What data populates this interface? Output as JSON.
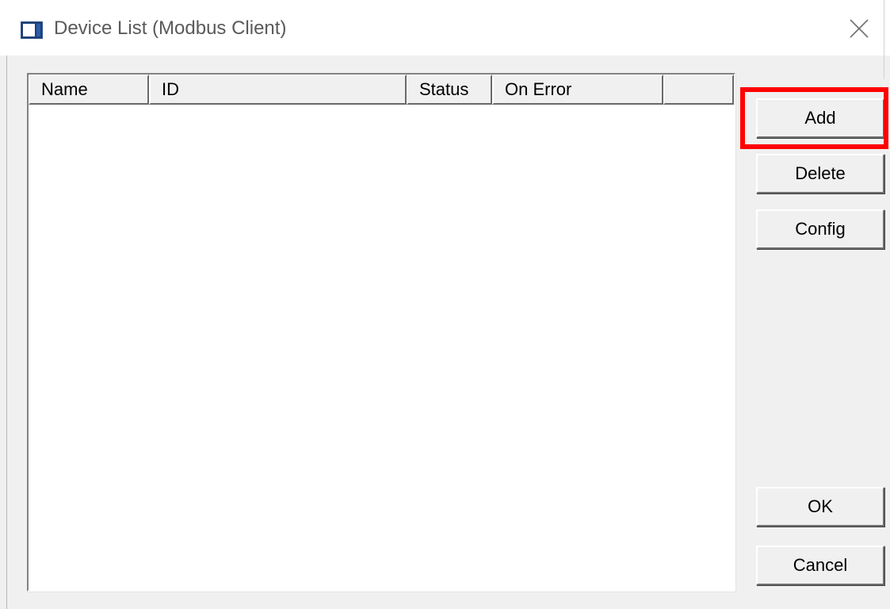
{
  "window": {
    "title": "Device List (Modbus Client)",
    "icon": "app-window-icon",
    "close_icon": "close-icon"
  },
  "device_list": {
    "columns": [
      "Name",
      "ID",
      "Status",
      "On Error",
      ""
    ],
    "rows": []
  },
  "buttons": {
    "add": "Add",
    "delete": "Delete",
    "config": "Config",
    "ok": "OK",
    "cancel": "Cancel"
  },
  "annotation": {
    "highlight_target": "add-button",
    "color": "#ff0000"
  }
}
